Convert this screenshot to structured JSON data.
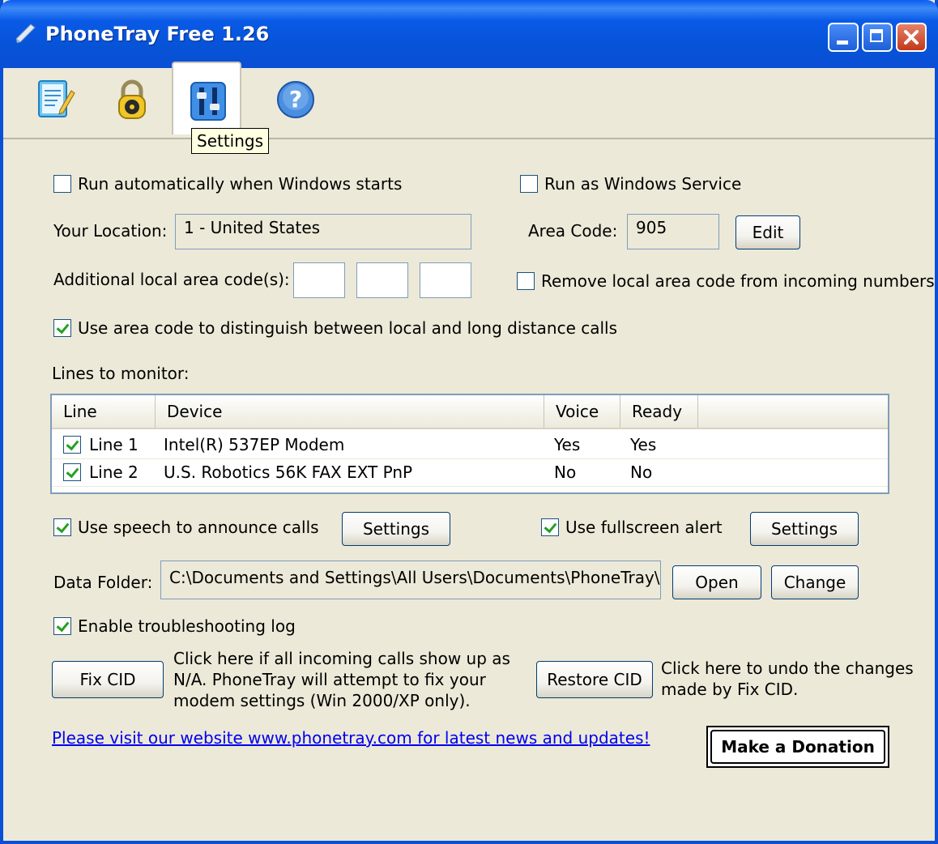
{
  "window": {
    "title": "PhoneTray Free 1.26"
  },
  "toolbar": {
    "tools": [
      {
        "name": "log",
        "icon": "notepad-icon"
      },
      {
        "name": "lock",
        "icon": "padlock-icon"
      },
      {
        "name": "settings",
        "icon": "settings-sliders-icon"
      },
      {
        "name": "help",
        "icon": "help-icon"
      }
    ],
    "tooltip": "Settings"
  },
  "options": {
    "run_auto": {
      "label": "Run automatically when Windows starts",
      "checked": false
    },
    "run_service": {
      "label": "Run as Windows Service",
      "checked": false
    },
    "location_label": "Your Location:",
    "location_value": "1 - United States",
    "area_code_label": "Area Code:",
    "area_code_value": "905",
    "edit_button": "Edit",
    "additional_label": "Additional local area code(s):",
    "additional_codes": [
      "",
      "",
      ""
    ],
    "remove_local": {
      "label": "Remove local area code from incoming numbers",
      "checked": false
    },
    "use_area_code": {
      "label": "Use area code to distinguish between local and long distance calls",
      "checked": true
    }
  },
  "lines": {
    "label": "Lines to monitor:",
    "columns": [
      "Line",
      "Device",
      "Voice",
      "Ready"
    ],
    "rows": [
      {
        "line": "Line 1",
        "device": "Intel(R) 537EP Modem",
        "voice": "Yes",
        "ready": "Yes",
        "checked": true
      },
      {
        "line": "Line 2",
        "device": "U.S. Robotics 56K FAX EXT PnP",
        "voice": "No",
        "ready": "No",
        "checked": true
      }
    ]
  },
  "alerts": {
    "speech": {
      "label": "Use speech to announce calls",
      "checked": true,
      "button": "Settings"
    },
    "fullscreen": {
      "label": "Use fullscreen alert",
      "checked": true,
      "button": "Settings"
    }
  },
  "data_folder": {
    "label": "Data Folder:",
    "value": "C:\\Documents and Settings\\All Users\\Documents\\PhoneTray\\",
    "open_button": "Open",
    "change_button": "Change"
  },
  "troubleshooting": {
    "label": "Enable troubleshooting log",
    "checked": true
  },
  "fix": {
    "fix_button": "Fix CID",
    "fix_text": [
      "Click here if all incoming calls show up as",
      "N/A. PhoneTray will attempt to fix your",
      "modem settings (Win 2000/XP only)."
    ],
    "restore_button": "Restore CID",
    "restore_text": [
      "Click here to undo the changes",
      "made by Fix CID."
    ]
  },
  "footer": {
    "link": "Please visit our website www.phonetray.com for latest news and updates!",
    "donate": "Make a Donation"
  }
}
